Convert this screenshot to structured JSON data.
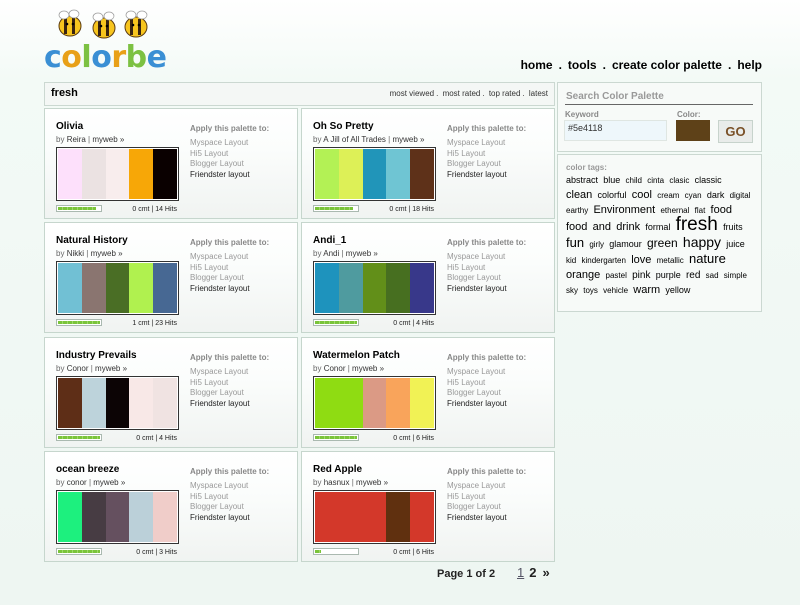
{
  "brand": {
    "name": "colorbe",
    "letters": [
      "c",
      "o",
      "l",
      "o",
      "r",
      "b",
      "e"
    ],
    "letter_colors": [
      "#3a8fd4",
      "#e8a017",
      "#7cc142",
      "#3a8fd4",
      "#e8a017",
      "#7cc142",
      "#3a8fd4"
    ]
  },
  "nav": {
    "items": [
      {
        "label": "home"
      },
      {
        "label": "tools"
      },
      {
        "label": "create color palette"
      },
      {
        "label": "help"
      }
    ],
    "separator": "."
  },
  "main": {
    "title": "fresh",
    "sort_links": [
      {
        "label": "most viewed"
      },
      {
        "label": "most rated"
      },
      {
        "label": "top rated"
      },
      {
        "label": "latest"
      }
    ],
    "sort_separator": "."
  },
  "apply_block": {
    "heading": "Apply this palette to:",
    "options": [
      "Myspace Layout",
      "Hi5 Layout",
      "Blogger Layout",
      "Friendster layout"
    ]
  },
  "palettes": [
    {
      "title": "Olivia",
      "by": "by",
      "author": "Reira",
      "sep": "|",
      "myweb": "myweb »",
      "colors": [
        "#fde0fb",
        "#ebe2e2",
        "#f8eded",
        "#f7a707",
        "#0a0000"
      ],
      "rating": 0.9,
      "comments": "0 cmt",
      "hits": "14 Hits"
    },
    {
      "title": "Oh So Pretty",
      "by": "by",
      "author": "A Jill of All Trades",
      "sep": "|",
      "myweb": "myweb »",
      "colors": [
        "#b3f155",
        "#ddf057",
        "#2195b9",
        "#6fc5d3",
        "#5e3119"
      ],
      "rating": 0.9,
      "comments": "0 cmt",
      "hits": "18 Hits"
    },
    {
      "title": "Natural History",
      "by": "by",
      "author": "Nikki",
      "sep": "|",
      "myweb": "myweb »",
      "colors": [
        "#71c0d4",
        "#8a7570",
        "#4a6e25",
        "#b0f14f",
        "#476893"
      ],
      "rating": 1.0,
      "comments": "1 cmt",
      "hits": "23 Hits"
    },
    {
      "title": "Andi_1",
      "by": "by",
      "author": "Andi",
      "sep": "|",
      "myweb": "myweb »",
      "colors": [
        "#1e93bd",
        "#4f9b9f",
        "#628f19",
        "#476f20",
        "#38388a"
      ],
      "rating": 1.0,
      "comments": "0 cmt",
      "hits": "4 Hits"
    },
    {
      "title": "Industry Prevails",
      "by": "by",
      "author": "Conor",
      "sep": "|",
      "myweb": "myweb »",
      "colors": [
        "#5e2e17",
        "#bdd3db",
        "#0c0405",
        "#f8e8e7",
        "#f0e3e2"
      ],
      "rating": 1.0,
      "comments": "0 cmt",
      "hits": "4 Hits"
    },
    {
      "title": "Watermelon Patch",
      "by": "by",
      "author": "Conor",
      "sep": "|",
      "myweb": "myweb »",
      "colors": [
        "#8fdc12",
        "#8fdc12",
        "#db9a85",
        "#f9a45b",
        "#f1f255"
      ],
      "rating": 1.0,
      "comments": "0 cmt",
      "hits": "6 Hits"
    },
    {
      "title": "ocean breeze",
      "by": "by",
      "author": "conor",
      "sep": "|",
      "myweb": "myweb »",
      "colors": [
        "#1df07e",
        "#473c43",
        "#65505f",
        "#bbd0d9",
        "#f0cdc9"
      ],
      "rating": 1.0,
      "comments": "0 cmt",
      "hits": "3 Hits"
    },
    {
      "title": "Red Apple",
      "by": "by",
      "author": "hasnux",
      "sep": "|",
      "myweb": "myweb »",
      "colors": [
        "#d3382a",
        "#d3382a",
        "#d3382a",
        "#60300f",
        "#d3382a"
      ],
      "rating": 0.15,
      "comments": "0 cmt",
      "hits": "6 Hits"
    }
  ],
  "pagination": {
    "label": "Page 1 of 2",
    "pages": [
      "1",
      "2"
    ],
    "next": "»"
  },
  "search": {
    "title": "Search Color Palette",
    "keyword_label": "Keyword",
    "keyword_value": "#5e4118",
    "color_label": "Color:",
    "color_value": "#5e4118",
    "go_label": "GO"
  },
  "tags": {
    "title": "color tags:",
    "items": [
      {
        "t": "abstract",
        "s": 9
      },
      {
        "t": "blue",
        "s": 9
      },
      {
        "t": "child",
        "s": 8
      },
      {
        "t": "cinta",
        "s": 8
      },
      {
        "t": "clasic",
        "s": 8
      },
      {
        "t": "classic",
        "s": 9
      },
      {
        "t": "clean",
        "s": 11
      },
      {
        "t": "colorful",
        "s": 9
      },
      {
        "t": "cool",
        "s": 11
      },
      {
        "t": "cream",
        "s": 8
      },
      {
        "t": "cyan",
        "s": 8
      },
      {
        "t": "dark",
        "s": 9
      },
      {
        "t": "digital",
        "s": 8
      },
      {
        "t": "earthy",
        "s": 8
      },
      {
        "t": "Environment",
        "s": 11
      },
      {
        "t": "ethernal",
        "s": 8
      },
      {
        "t": "flat",
        "s": 8
      },
      {
        "t": "food",
        "s": 11
      },
      {
        "t": "food",
        "s": 11
      },
      {
        "t": "and",
        "s": 11
      },
      {
        "t": "drink",
        "s": 11
      },
      {
        "t": "formal",
        "s": 9
      },
      {
        "t": "fresh",
        "s": 19
      },
      {
        "t": "fruits",
        "s": 9
      },
      {
        "t": "fun",
        "s": 13
      },
      {
        "t": "girly",
        "s": 8
      },
      {
        "t": "glamour",
        "s": 9
      },
      {
        "t": "green",
        "s": 12
      },
      {
        "t": "happy",
        "s": 14
      },
      {
        "t": "juice",
        "s": 9
      },
      {
        "t": "kid",
        "s": 8
      },
      {
        "t": "kindergarten",
        "s": 8
      },
      {
        "t": "love",
        "s": 11
      },
      {
        "t": "metallic",
        "s": 8
      },
      {
        "t": "nature",
        "s": 13
      },
      {
        "t": "orange",
        "s": 11
      },
      {
        "t": "pastel",
        "s": 8
      },
      {
        "t": "pink",
        "s": 10
      },
      {
        "t": "purple",
        "s": 9
      },
      {
        "t": "red",
        "s": 10
      },
      {
        "t": "sad",
        "s": 8
      },
      {
        "t": "simple",
        "s": 8
      },
      {
        "t": "sky",
        "s": 8
      },
      {
        "t": "toys",
        "s": 8
      },
      {
        "t": "vehicle",
        "s": 8
      },
      {
        "t": "warm",
        "s": 11
      },
      {
        "t": "yellow",
        "s": 9
      }
    ]
  }
}
